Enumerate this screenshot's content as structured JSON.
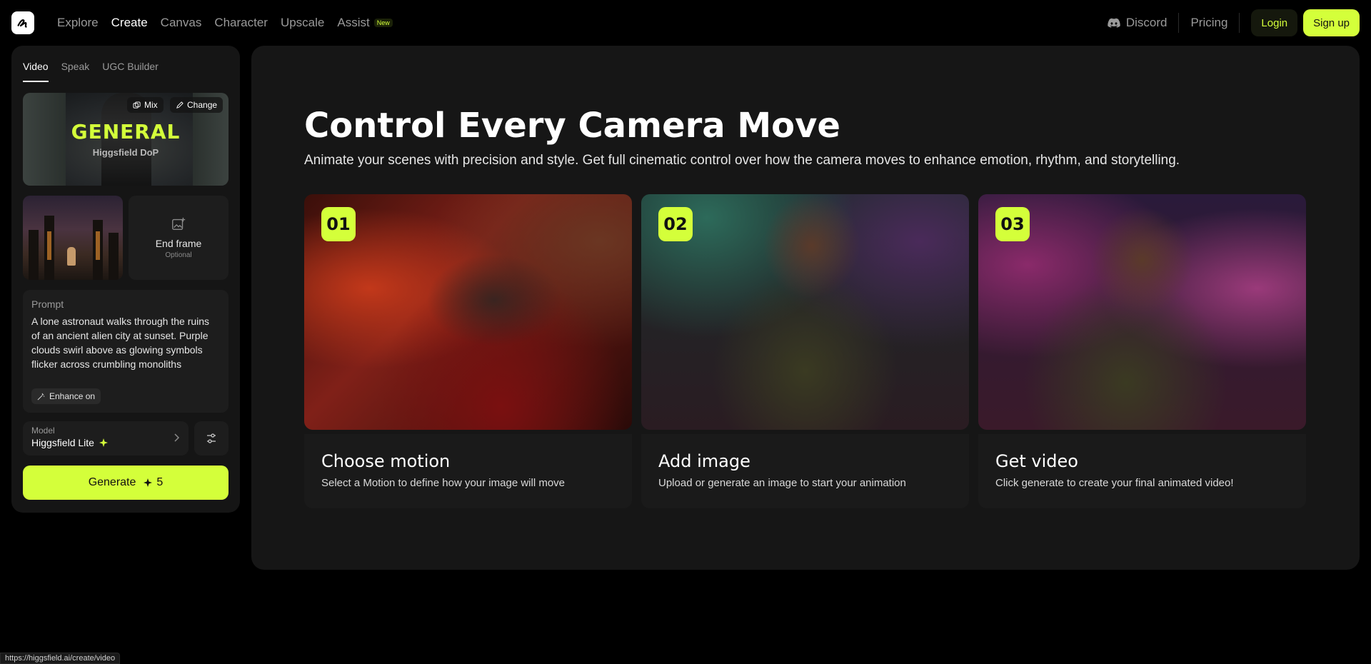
{
  "header": {
    "nav": [
      {
        "label": "Explore",
        "active": false
      },
      {
        "label": "Create",
        "active": true
      },
      {
        "label": "Canvas",
        "active": false
      },
      {
        "label": "Character",
        "active": false
      },
      {
        "label": "Upscale",
        "active": false
      },
      {
        "label": "Assist",
        "active": false
      }
    ],
    "new_badge": "New",
    "discord": "Discord",
    "pricing": "Pricing",
    "login": "Login",
    "signup": "Sign up"
  },
  "sidebar": {
    "tabs": [
      {
        "label": "Video",
        "active": true
      },
      {
        "label": "Speak",
        "active": false
      },
      {
        "label": "UGC Builder",
        "active": false
      }
    ],
    "motion": {
      "title": "GENERAL",
      "subtitle": "Higgsfield DoP",
      "mix_label": "Mix",
      "change_label": "Change"
    },
    "end_frame": {
      "title": "End frame",
      "subtitle": "Optional"
    },
    "prompt": {
      "label": "Prompt",
      "text": "A lone astronaut walks through the ruins of an ancient alien city at sunset. Purple clouds swirl above as glowing symbols flicker across crumbling monoliths",
      "enhance_label": "Enhance on"
    },
    "model": {
      "label": "Model",
      "value": "Higgsfield Lite"
    },
    "generate": {
      "label": "Generate",
      "cost": "5"
    }
  },
  "main": {
    "title": "Control Every Camera Move",
    "subtitle": "Animate your scenes with precision and style. Get full cinematic control over how the camera moves to enhance emotion, rhythm, and storytelling.",
    "cards": [
      {
        "number": "01",
        "title": "Choose motion",
        "desc": "Select a Motion to define how your image will move"
      },
      {
        "number": "02",
        "title": "Add image",
        "desc": "Upload or generate an image to start your animation"
      },
      {
        "number": "03",
        "title": "Get video",
        "desc": "Click generate to create your final animated video!"
      }
    ]
  },
  "status_url": "https://higgsfield.ai/create/video",
  "colors": {
    "accent": "#d4ff3a",
    "bg": "#000000",
    "panel": "#161616"
  }
}
